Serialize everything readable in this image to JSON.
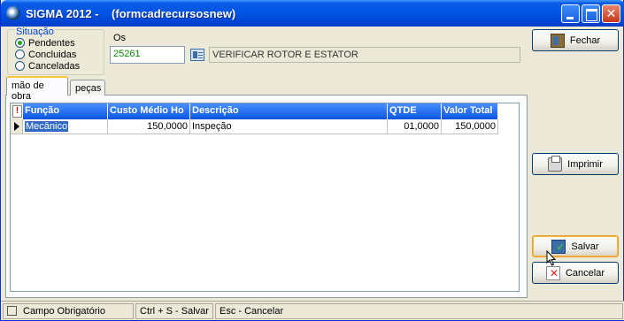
{
  "window": {
    "title": "SIGMA 2012 -    (formcadrecursosnew)"
  },
  "situacao": {
    "label": "Situação",
    "options": [
      "Pendentes",
      "Concluidas",
      "Canceladas"
    ],
    "selected": "Pendentes"
  },
  "os": {
    "label": "Os",
    "value": "25261",
    "description": "VERIFICAR ROTOR E ESTATOR"
  },
  "tabs": [
    {
      "label": "mão de obra",
      "active": true
    },
    {
      "label": "peças",
      "active": false
    }
  ],
  "grid": {
    "columns": [
      "Função",
      "Custo Médio Ho",
      "Descrição",
      "QTDE",
      "Valor Total"
    ],
    "rows": [
      {
        "funcao": "Mecânico",
        "custo": "150,0000",
        "descricao": "Inspeção",
        "qtde": "01,0000",
        "valor": "150,0000"
      }
    ]
  },
  "buttons": {
    "fechar": "Fechar",
    "imprimir": "Imprimir",
    "salvar": "Salvar",
    "cancelar": "Cancelar"
  },
  "statusbar": {
    "campo": "Campo Obrigatório",
    "save_hint": "Ctrl + S - Salvar",
    "cancel_hint": "Esc - Cancelar"
  },
  "colors": {
    "titlebar": "#0055e5",
    "grid_header": "#0a56e0",
    "selection": "#316ac5"
  }
}
